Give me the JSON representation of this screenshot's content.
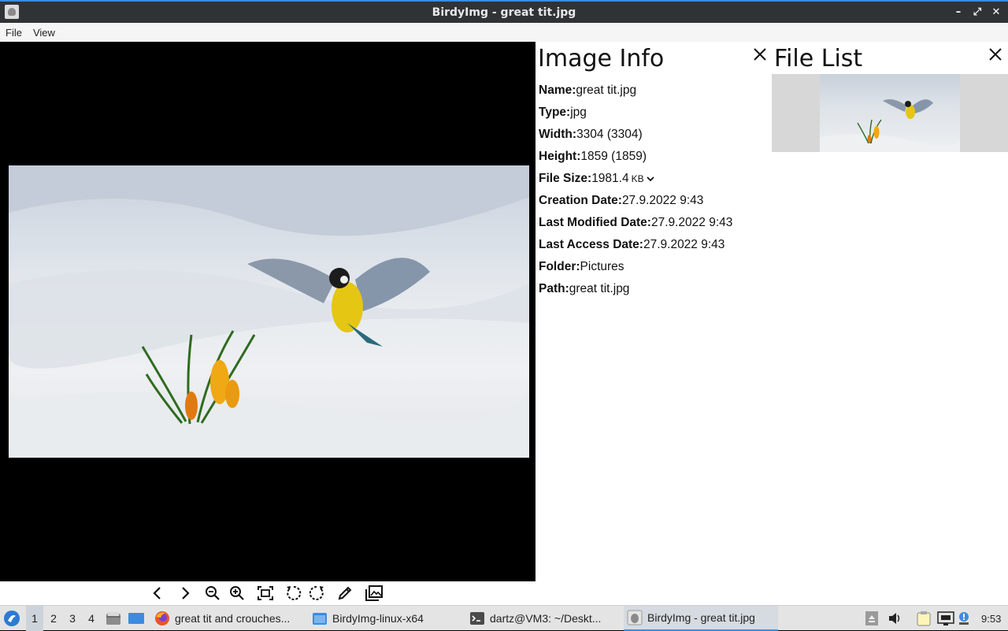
{
  "window": {
    "title": "BirdyImg - great tit.jpg",
    "minimize_glyph": "–",
    "maximize_glyph": "⤢",
    "close_glyph": "✕"
  },
  "menu": {
    "items": [
      "File",
      "View"
    ]
  },
  "info_panel": {
    "title": "Image Info",
    "rows": [
      {
        "label": "Name:",
        "value": "great tit.jpg"
      },
      {
        "label": "Type:",
        "value": "jpg"
      },
      {
        "label": "Width:",
        "value": "3304 (3304)"
      },
      {
        "label": "Height:",
        "value": "1859 (1859)"
      },
      {
        "label": "File Size:",
        "value": "1981.4",
        "unit": "KB"
      },
      {
        "label": "Creation Date:",
        "value": "27.9.2022 9:43"
      },
      {
        "label": "Last Modified Date:",
        "value": "27.9.2022 9:43"
      },
      {
        "label": "Last Access Date:",
        "value": "27.9.2022 9:43"
      },
      {
        "label": "Folder:",
        "value": "Pictures"
      },
      {
        "label": "Path:",
        "value": "great tit.jpg"
      }
    ]
  },
  "file_list": {
    "title": "File List"
  },
  "toolbar": {
    "icons": [
      "previous-icon",
      "next-icon",
      "zoom-out-icon",
      "zoom-in-icon",
      "fit-to-window-icon",
      "rotate-left-icon",
      "rotate-right-icon",
      "edit-icon",
      "gallery-icon"
    ]
  },
  "taskbar": {
    "workspaces": [
      "1",
      "2",
      "3",
      "4"
    ],
    "tasks": [
      {
        "label": "great tit and crouches...",
        "icon": "firefox-icon"
      },
      {
        "label": "BirdyImg-linux-x64",
        "icon": "folder-icon"
      },
      {
        "label": "dartz@VM3: ~/Deskt...",
        "icon": "terminal-icon"
      },
      {
        "label": "BirdyImg - great tit.jpg",
        "icon": "birdyimg-icon"
      }
    ],
    "clock": "9:53"
  }
}
